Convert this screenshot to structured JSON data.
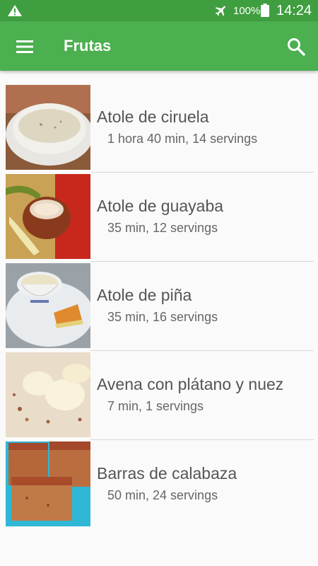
{
  "status_bar": {
    "battery_percent": "100%",
    "time": "14:24",
    "icons": [
      "warning-icon",
      "airplane-mode-icon",
      "battery-icon"
    ]
  },
  "app_bar": {
    "title": "Frutas",
    "icons": [
      "menu-icon",
      "search-icon"
    ],
    "color": "#4caf50"
  },
  "recipes": [
    {
      "title": "Atole de ciruela",
      "meta": "1 hora 40 min, 14 servings"
    },
    {
      "title": "Atole de guayaba",
      "meta": "35 min, 12 servings"
    },
    {
      "title": "Atole de piña",
      "meta": "35 min, 16 servings"
    },
    {
      "title": "Avena con plátano y nuez",
      "meta": "7 min, 1 servings"
    },
    {
      "title": "Barras de calabaza",
      "meta": "50 min, 24 servings"
    }
  ]
}
